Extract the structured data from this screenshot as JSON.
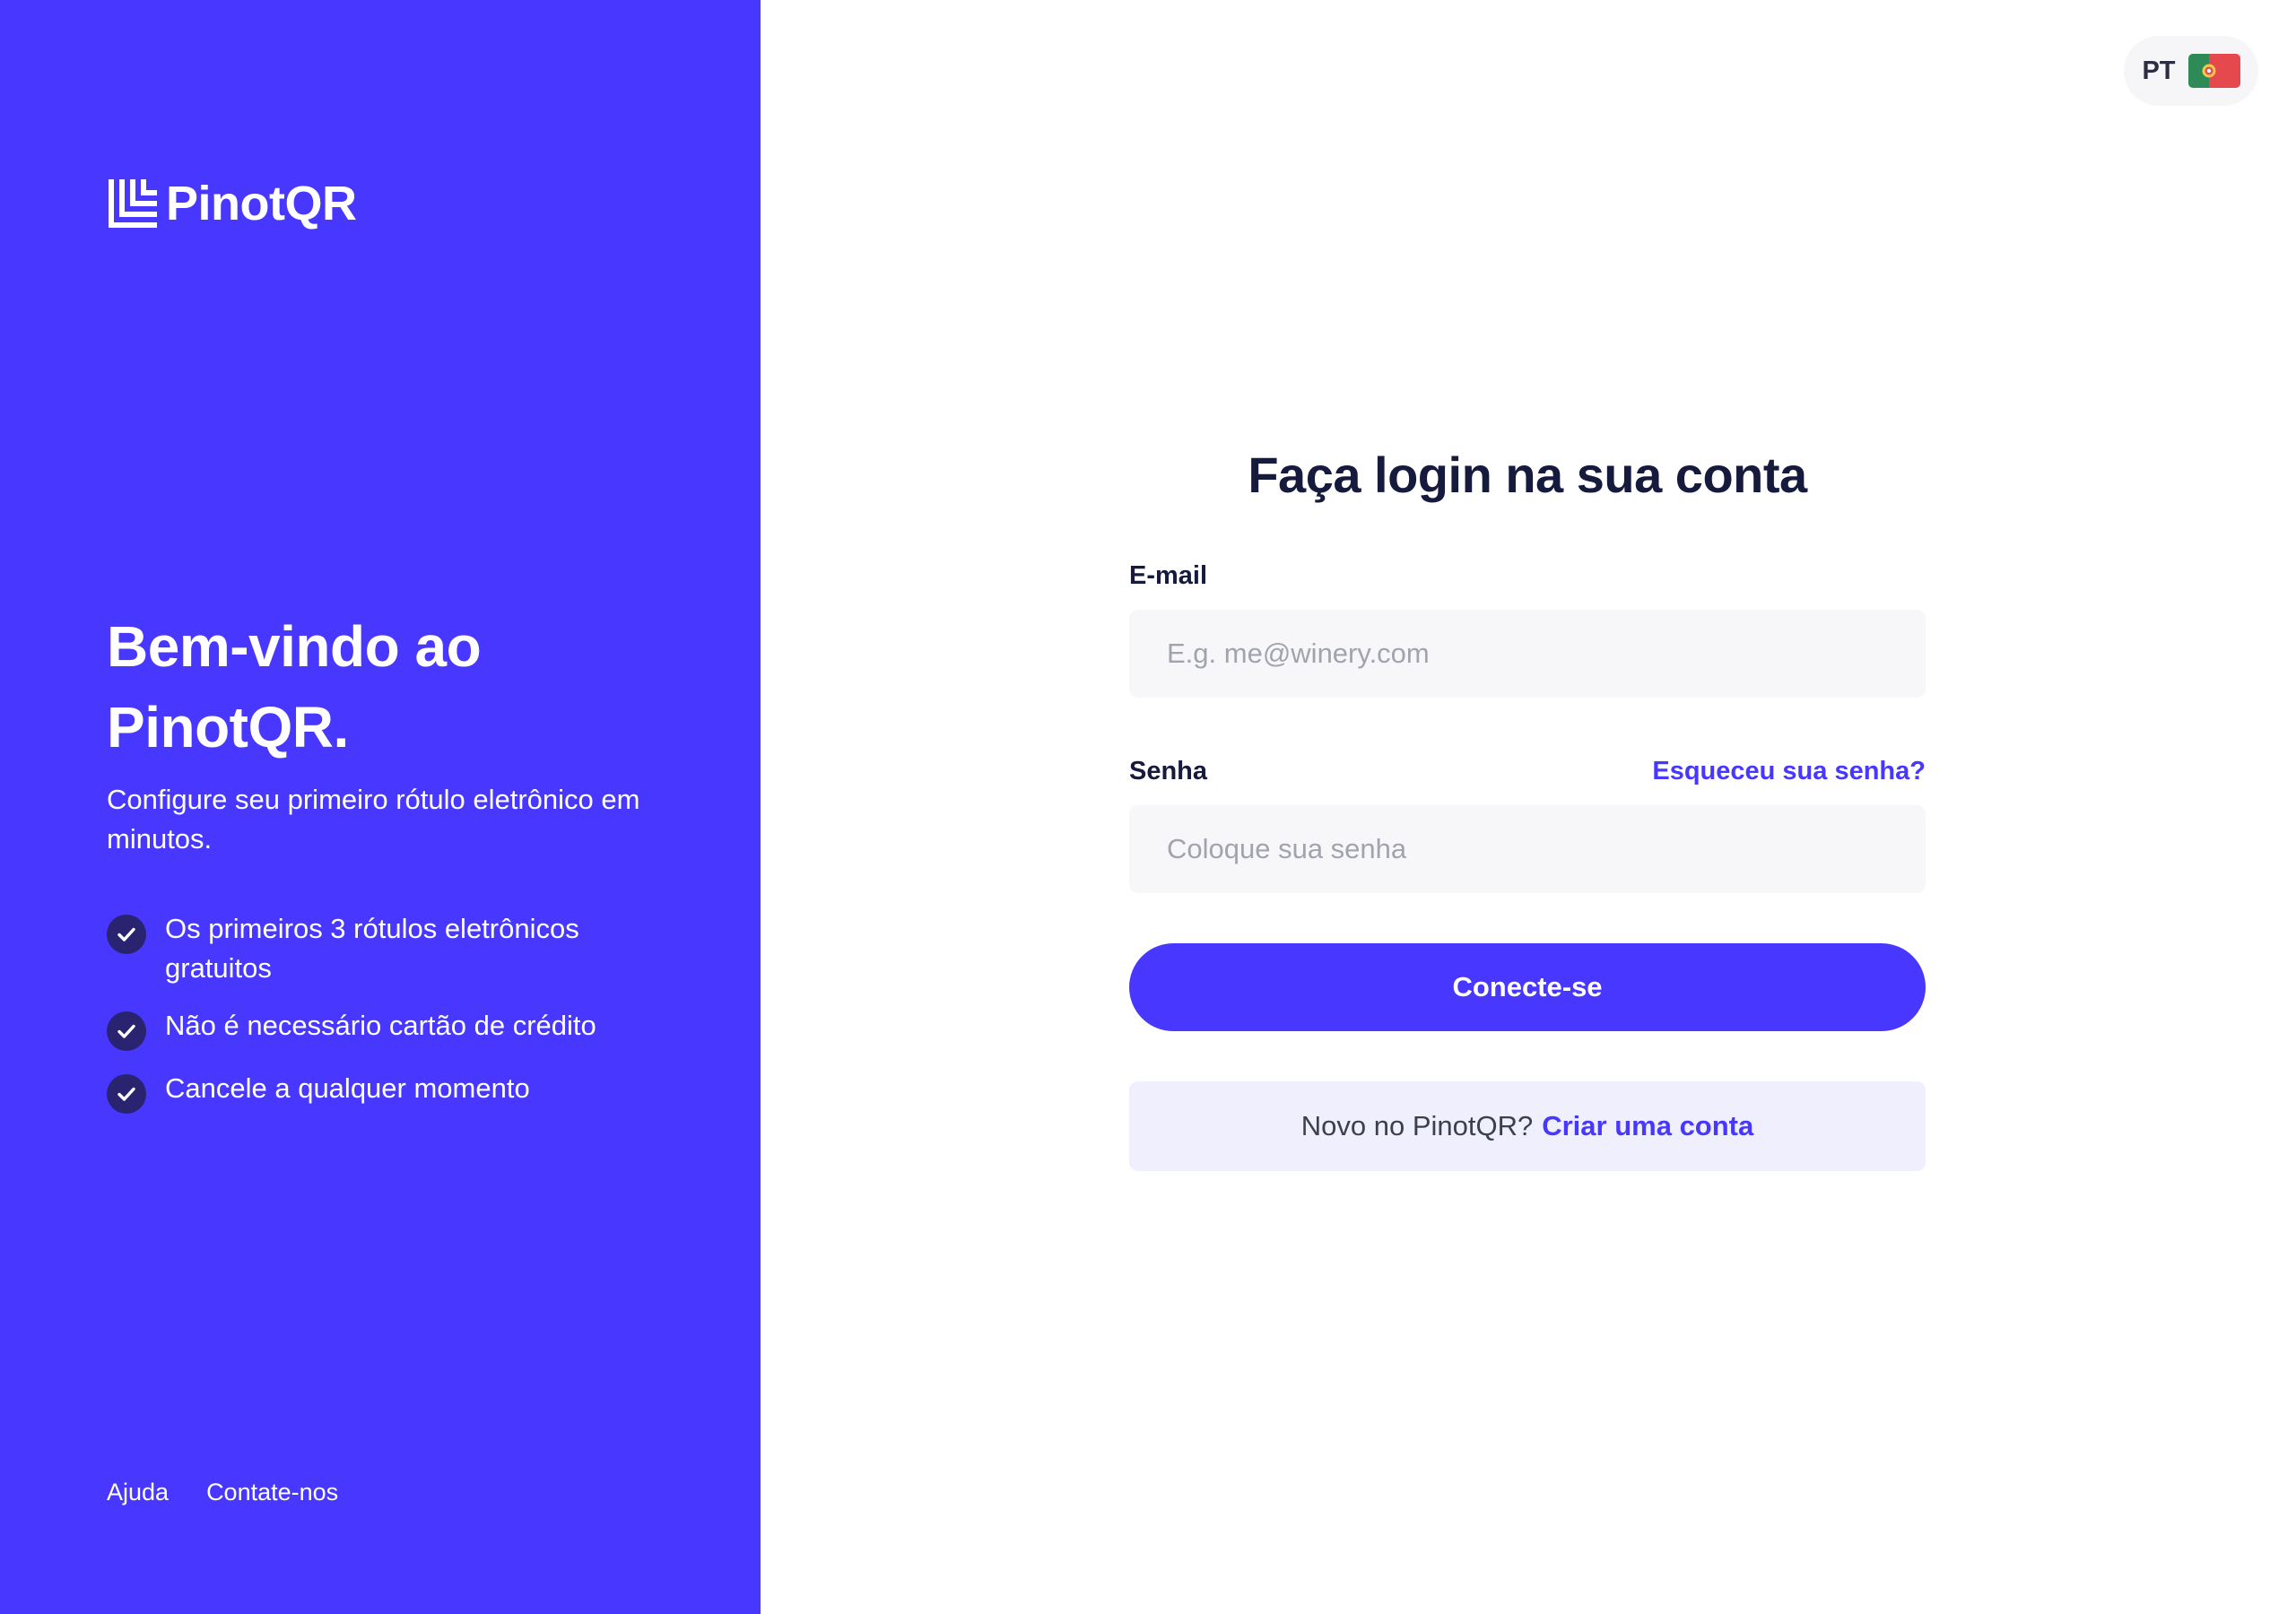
{
  "brand": {
    "name": "PinotQR",
    "logo_icon": "pinotqr-logo-icon"
  },
  "left_panel": {
    "welcome_line1": "Bem-vindo ao",
    "welcome_line2": "PinotQR.",
    "subtitle": "Configure seu primeiro rótulo eletrônico em minutos.",
    "features": [
      {
        "text": "Os primeiros 3 rótulos eletrônicos gratuitos",
        "icon": "check-circle-icon"
      },
      {
        "text": "Não é necessário cartão de crédito",
        "icon": "check-circle-icon"
      },
      {
        "text": "Cancele a qualquer momento",
        "icon": "check-circle-icon"
      }
    ],
    "footer_links": [
      "Ajuda",
      "Contate-nos"
    ]
  },
  "language": {
    "code": "PT",
    "flag_icon": "portugal-flag-icon"
  },
  "login": {
    "title": "Faça login na sua conta",
    "email_label": "E-mail",
    "email_placeholder": "E.g. me@winery.com",
    "email_value": "",
    "password_label": "Senha",
    "forgot_password": "Esqueceu sua senha?",
    "password_placeholder": "Coloque sua senha",
    "password_value": "",
    "submit_label": "Conecte-se",
    "signup_prompt": "Novo no PinotQR?",
    "signup_link": "Criar uma conta"
  },
  "colors": {
    "brand_primary": "#4838ff",
    "heading_dark": "#161a3c",
    "check_circle": "#2a2370",
    "input_background": "#f7f7f9",
    "signup_background": "#efeffd"
  }
}
